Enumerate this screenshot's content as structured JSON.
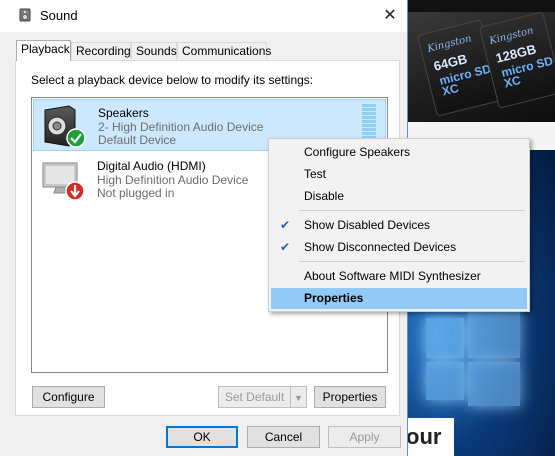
{
  "window": {
    "title": "Sound",
    "close_glyph": "✕"
  },
  "tabs": [
    {
      "label": "Playback",
      "active": true
    },
    {
      "label": "Recording",
      "active": false
    },
    {
      "label": "Sounds",
      "active": false
    },
    {
      "label": "Communications",
      "active": false
    }
  ],
  "instruction": "Select a playback device below to modify its settings:",
  "devices": [
    {
      "name": "Speakers",
      "line1": "2- High Definition Audio Device",
      "line2": "Default Device",
      "icon": "speaker-icon",
      "status_icon": "check-badge-icon",
      "selected": true
    },
    {
      "name": "Digital Audio (HDMI)",
      "line1": "High Definition Audio Device",
      "line2": "Not plugged in",
      "icon": "monitor-icon",
      "status_icon": "down-arrow-badge-icon",
      "selected": false
    }
  ],
  "context_menu": {
    "items": [
      {
        "label": "Configure Speakers",
        "checked": false,
        "highlighted": false
      },
      {
        "label": "Test",
        "checked": false,
        "highlighted": false
      },
      {
        "label": "Disable",
        "checked": false,
        "highlighted": false
      },
      {
        "label": "Show Disabled Devices",
        "checked": true,
        "highlighted": false
      },
      {
        "label": "Show Disconnected Devices",
        "checked": true,
        "highlighted": false
      },
      {
        "label": "About Software MIDI Synthesizer",
        "checked": false,
        "highlighted": false
      },
      {
        "label": "Properties",
        "checked": false,
        "highlighted": true
      }
    ],
    "check_glyph": "✔"
  },
  "panel_buttons": {
    "configure": "Configure",
    "set_default": "Set Default",
    "properties": "Properties"
  },
  "dialog_buttons": {
    "ok": "OK",
    "cancel": "Cancel",
    "apply": "Apply"
  },
  "background": {
    "ad_cards": [
      {
        "brand": "Kingston",
        "capacity": "64GB",
        "mark": "micro SD XC"
      },
      {
        "brand": "Kingston",
        "capacity": "128GB",
        "mark": "micro SD XC"
      }
    ],
    "partial_text": "our"
  },
  "colors": {
    "selection": "#cce8ff",
    "menu_highlight": "#91c9f7",
    "accent": "#0078d7"
  }
}
